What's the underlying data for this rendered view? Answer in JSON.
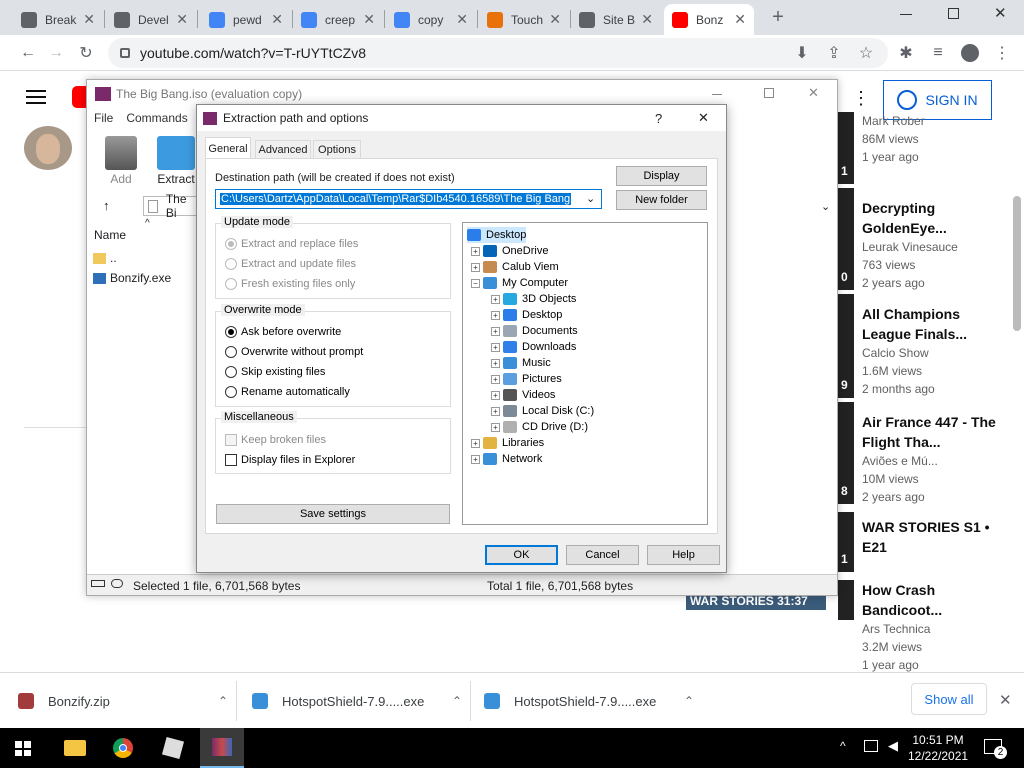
{
  "browser": {
    "tabs": [
      {
        "label": "Break",
        "color": "#5f6368"
      },
      {
        "label": "Devel",
        "color": "#5f6368"
      },
      {
        "label": "pewd",
        "color": "#4285f4"
      },
      {
        "label": "creep",
        "color": "#4285f4"
      },
      {
        "label": "copy",
        "color": "#4285f4"
      },
      {
        "label": "Touch",
        "color": "#e8710a"
      },
      {
        "label": "Site B",
        "color": "#5f6368"
      },
      {
        "label": "Bonz",
        "color": "#ff0000"
      }
    ],
    "url": "youtube.com/watch?v=T-rUYTtCZv8",
    "new_tab": "+"
  },
  "youtube": {
    "sign_in": "SIGN IN",
    "sidebar": [
      {
        "title": "",
        "channel": "Mark Rober",
        "views": "86M views",
        "age": "1 year ago",
        "thumb_text": "1"
      },
      {
        "title": "Decrypting GoldenEye...",
        "channel": "Leurak Vinesauce",
        "views": "763 views",
        "age": "2 years ago",
        "thumb_text": "0"
      },
      {
        "title": "All Champions League Finals...",
        "channel": "Calcio Show",
        "views": "1.6M views",
        "age": "2 months ago",
        "thumb_text": "9"
      },
      {
        "title": "Air France 447 - The Flight Tha...",
        "channel": "Aviões e Mú...",
        "views": "10M views",
        "age": "2 years ago",
        "thumb_text": "8"
      },
      {
        "title": "WAR STORIES S1 • E21",
        "channel": "",
        "views": "",
        "age": "",
        "thumb_text": "1"
      },
      {
        "title": "How Crash Bandicoot...",
        "channel": "Ars Technica",
        "views": "3.2M views",
        "age": "1 year ago",
        "thumb_text": "WAR STORIES 31:37"
      }
    ]
  },
  "winrar": {
    "title": "The Big Bang.iso (evaluation copy)",
    "menu": [
      "File",
      "Commands"
    ],
    "toolbar": [
      {
        "label": "Add"
      },
      {
        "label": "Extract"
      }
    ],
    "path_prefix": "The Bi",
    "column_name": "Name",
    "files": [
      {
        "name": ".."
      },
      {
        "name": "Bonzify.exe"
      }
    ],
    "status_left": "Selected 1 file, 6,701,568 bytes",
    "status_right": "Total 1 file, 6,701,568 bytes"
  },
  "dialog": {
    "title": "Extraction path and options",
    "help": "?",
    "close": "✕",
    "tabs": [
      "General",
      "Advanced",
      "Options"
    ],
    "dest_label": "Destination path (will be created if does not exist)",
    "dest_path": "C:\\Users\\Dartz\\AppData\\Local\\Temp\\Rar$DIb4540.16589\\The Big Bang",
    "display_btn": "Display",
    "new_folder_btn": "New folder",
    "update_mode": {
      "label": "Update mode",
      "options": [
        "Extract and replace files",
        "Extract and update files",
        "Fresh existing files only"
      ],
      "selected": 0
    },
    "overwrite_mode": {
      "label": "Overwrite mode",
      "options": [
        "Ask before overwrite",
        "Overwrite without prompt",
        "Skip existing files",
        "Rename automatically"
      ],
      "selected": 0
    },
    "misc": {
      "label": "Miscellaneous",
      "options": [
        "Keep broken files",
        "Display files in Explorer"
      ]
    },
    "save_settings": "Save settings",
    "tree": [
      {
        "label": "Desktop",
        "level": 0,
        "icon": "#2b7de9"
      },
      {
        "label": "OneDrive",
        "level": 1,
        "icon": "#0364b8"
      },
      {
        "label": "Calub Viem",
        "level": 1,
        "icon": "#c58b4f"
      },
      {
        "label": "My Computer",
        "level": 1,
        "icon": "#3a8fd9"
      },
      {
        "label": "3D Objects",
        "level": 2,
        "icon": "#28a8e0"
      },
      {
        "label": "Desktop",
        "level": 2,
        "icon": "#2b7de9"
      },
      {
        "label": "Documents",
        "level": 2,
        "icon": "#9aa6b2"
      },
      {
        "label": "Downloads",
        "level": 2,
        "icon": "#2f80e8"
      },
      {
        "label": "Music",
        "level": 2,
        "icon": "#3a8fd9"
      },
      {
        "label": "Pictures",
        "level": 2,
        "icon": "#5aa0e0"
      },
      {
        "label": "Videos",
        "level": 2,
        "icon": "#555555"
      },
      {
        "label": "Local Disk (C:)",
        "level": 2,
        "icon": "#7c8a96"
      },
      {
        "label": "CD Drive (D:)",
        "level": 2,
        "icon": "#b0b0b0"
      },
      {
        "label": "Libraries",
        "level": 1,
        "icon": "#e3b341"
      },
      {
        "label": "Network",
        "level": 1,
        "icon": "#3a8fd9"
      }
    ],
    "ok": "OK",
    "cancel": "Cancel",
    "help_btn": "Help"
  },
  "downloads": {
    "items": [
      {
        "name": "Bonzify.zip",
        "icon": "#a23b3b"
      },
      {
        "name": "HotspotShield-7.9.....exe",
        "icon": "#3a8fd9"
      },
      {
        "name": "HotspotShield-7.9.....exe",
        "icon": "#3a8fd9"
      }
    ],
    "show_all": "Show all"
  },
  "taskbar": {
    "time": "10:51 PM",
    "date": "12/22/2021",
    "notifications": "2"
  }
}
